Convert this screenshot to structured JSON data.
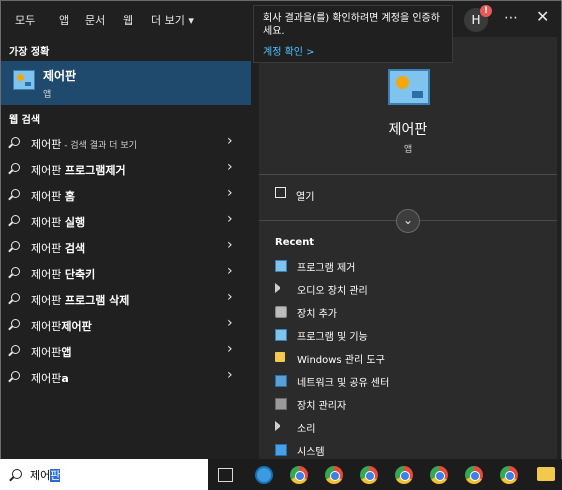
{
  "tabs": [
    {
      "label": "모두"
    },
    {
      "label": "앱"
    },
    {
      "label": "문서"
    },
    {
      "label": "웹"
    },
    {
      "label": "더 보기 ▾"
    }
  ],
  "best_match": {
    "header": "가장 정확",
    "title": "제어판",
    "subtitle": "앱"
  },
  "web_search": {
    "header": "웹 검색",
    "items": [
      {
        "prefix": "제어판",
        "bold": "",
        "suffix": " - 검색 결과 더 보기"
      },
      {
        "prefix": "제어판 ",
        "bold": "프로그램제거",
        "suffix": ""
      },
      {
        "prefix": "제어판 ",
        "bold": "홈",
        "suffix": ""
      },
      {
        "prefix": "제어판 ",
        "bold": "실행",
        "suffix": ""
      },
      {
        "prefix": "제어판 ",
        "bold": "검색",
        "suffix": ""
      },
      {
        "prefix": "제어판 ",
        "bold": "단축키",
        "suffix": ""
      },
      {
        "prefix": "제어판 ",
        "bold": "프로그램 삭제",
        "suffix": ""
      },
      {
        "prefix": "제어판",
        "bold": "제어판",
        "suffix": ""
      },
      {
        "prefix": "제어판",
        "bold": "앱",
        "suffix": ""
      },
      {
        "prefix": "제어판",
        "bold": "a",
        "suffix": ""
      }
    ]
  },
  "detail": {
    "title": "제어판",
    "subtitle": "앱",
    "open_label": "열기",
    "recent_header": "Recent",
    "recent": [
      {
        "label": "프로그램 제거",
        "icon": "control-panel-icon"
      },
      {
        "label": "오디오 장치 관리",
        "icon": "speaker-icon"
      },
      {
        "label": "장치 추가",
        "icon": "device-icon"
      },
      {
        "label": "프로그램 및 기능",
        "icon": "control-panel-icon"
      },
      {
        "label": "Windows 관리 도구",
        "icon": "folder-icon"
      },
      {
        "label": "네트워크 및 공유 센터",
        "icon": "network-icon"
      },
      {
        "label": "장치 관리자",
        "icon": "device-manager-icon"
      },
      {
        "label": "소리",
        "icon": "speaker-icon"
      },
      {
        "label": "시스템",
        "icon": "system-icon"
      }
    ]
  },
  "toast": {
    "message": "회사 결과을(를) 확인하려면 계정을 인증하세요.",
    "link": "계정 확인 >"
  },
  "user": {
    "initial": "H",
    "alert": "!"
  },
  "search": {
    "typed": "제어",
    "selected": "판"
  },
  "colors": {
    "accent": "#4cc2ff",
    "selection": "#1f4a6e"
  }
}
